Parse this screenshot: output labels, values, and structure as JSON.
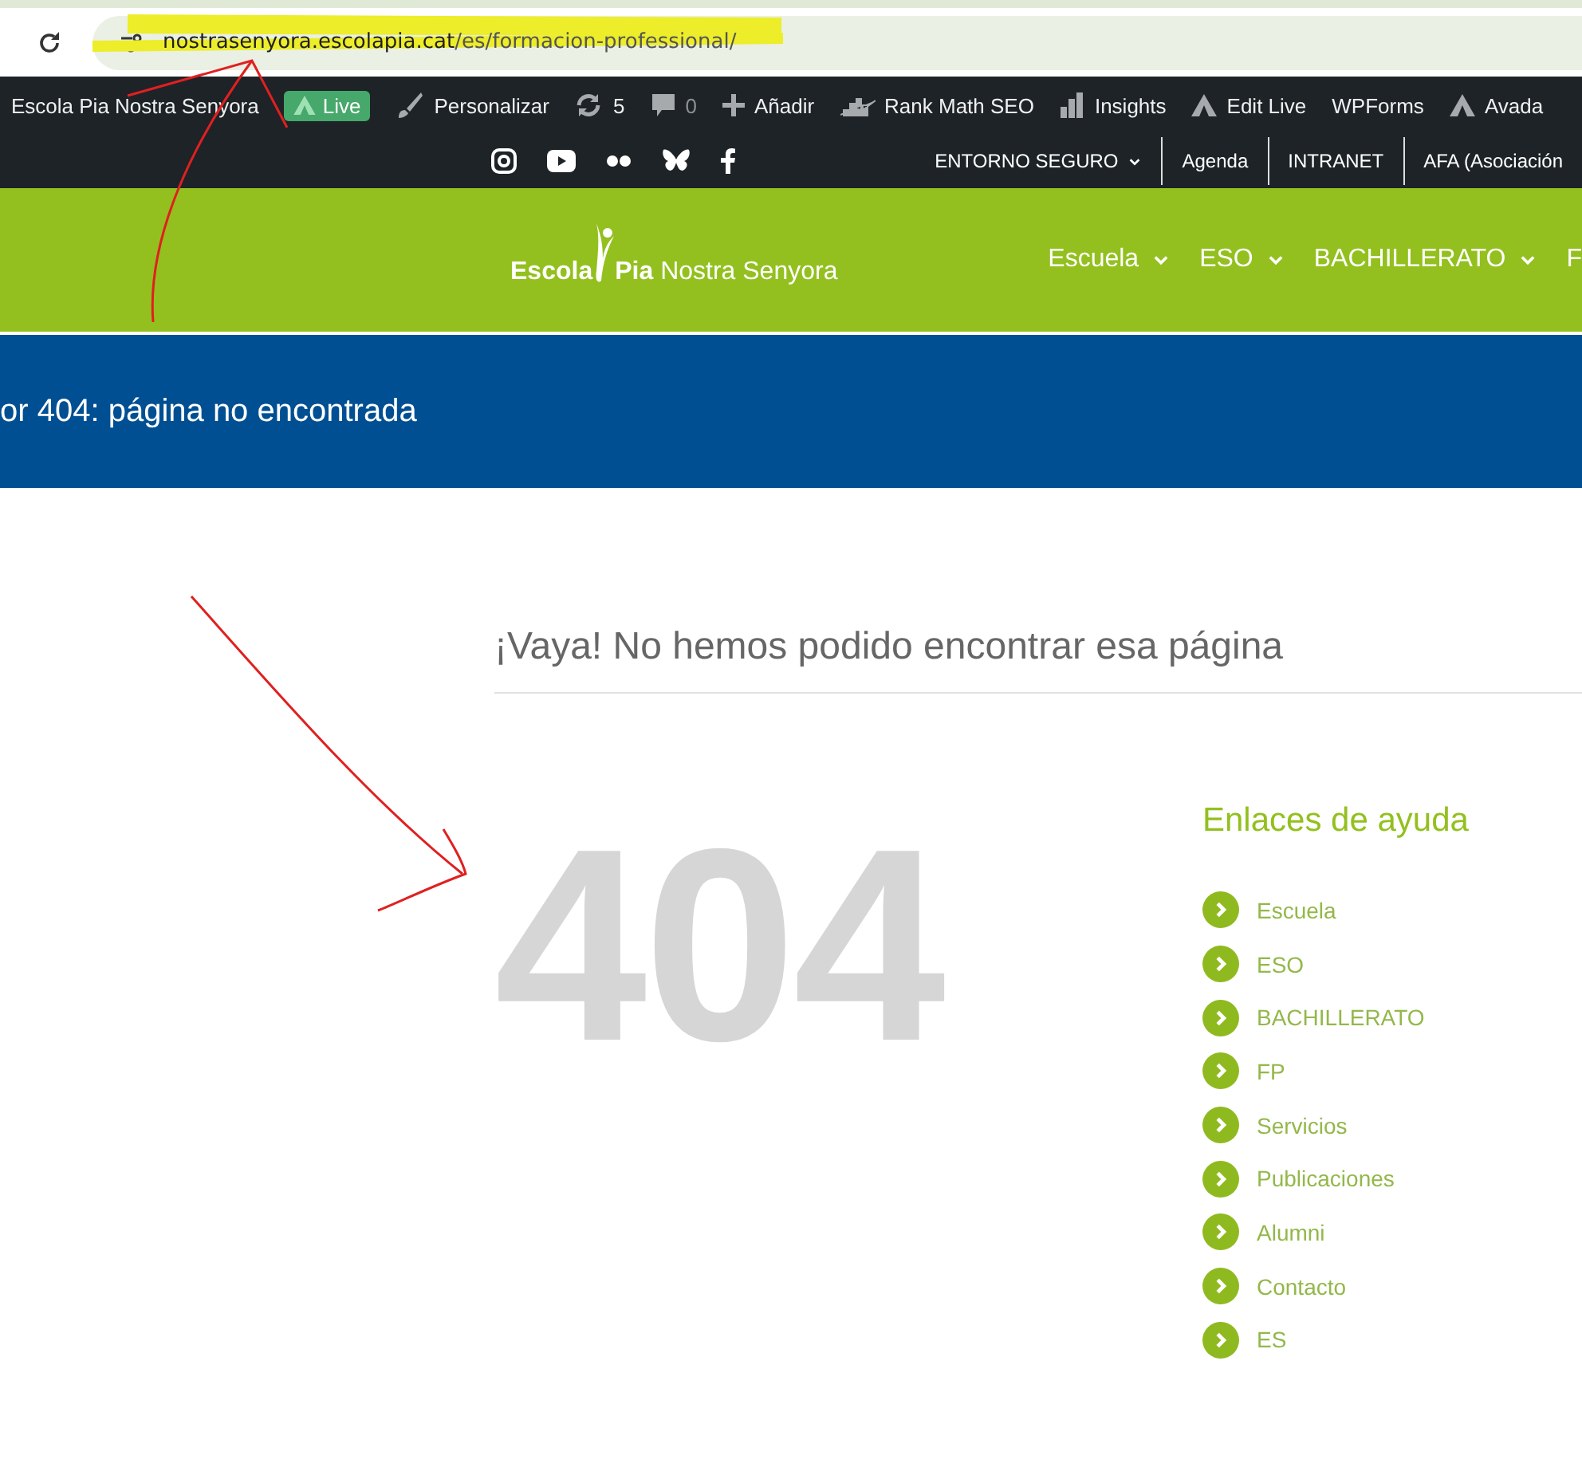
{
  "browser": {
    "url_host": "nostrasenyora.escolapia.cat",
    "url_path": "/es/formacion-professional/"
  },
  "admin_bar": {
    "items": [
      {
        "kind": "site",
        "label": "Escola Pia Nostra Senyora"
      },
      {
        "kind": "live",
        "label": "Live"
      },
      {
        "kind": "customize",
        "label": "Personalizar"
      },
      {
        "kind": "updates",
        "label": "5"
      },
      {
        "kind": "comments",
        "label": "0"
      },
      {
        "kind": "new",
        "label": "Añadir"
      },
      {
        "kind": "seo",
        "label": "Rank Math SEO"
      },
      {
        "kind": "insights",
        "label": "Insights"
      },
      {
        "kind": "avada",
        "label": "Edit Live"
      },
      {
        "kind": "plain",
        "label": "WPForms"
      },
      {
        "kind": "avada",
        "label": "Avada"
      }
    ]
  },
  "top_menu": [
    {
      "label": "ENTORNO SEGURO",
      "has_caret": true
    },
    {
      "label": "Agenda",
      "has_caret": false
    },
    {
      "label": "INTRANET",
      "has_caret": false
    },
    {
      "label": "AFA (Asociación",
      "has_caret": false
    }
  ],
  "logo": {
    "word_1": "Escola",
    "word_2": "Pia",
    "rest": "Nostra Senyora"
  },
  "main_nav": [
    {
      "label": "Escuela",
      "has_caret": true
    },
    {
      "label": "ESO",
      "has_caret": true
    },
    {
      "label": "BACHILLERATO",
      "has_caret": true
    },
    {
      "label": "F",
      "has_caret": false
    }
  ],
  "page_title": "or 404: página no encontrada",
  "heading": "¡Vaya! No hemos podido encontrar esa página",
  "error_code": "404",
  "help_links": {
    "title": "Enlaces de ayuda",
    "items": [
      "Escuela",
      "ESO",
      "BACHILLERATO",
      "FP",
      "Servicios",
      "Publicaciones",
      "Alumni",
      "Contacto",
      "ES"
    ]
  }
}
